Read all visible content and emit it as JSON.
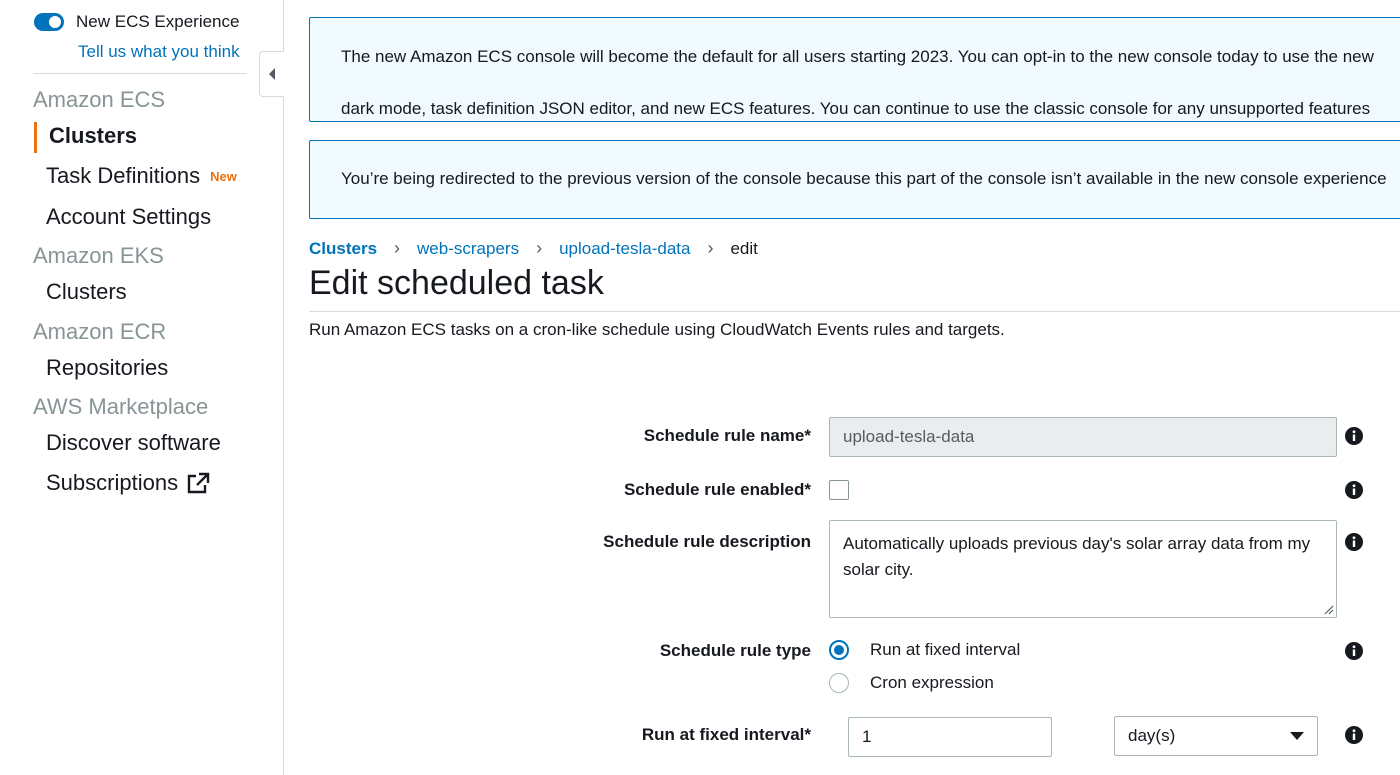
{
  "sidebar": {
    "toggle_label": "New ECS Experience",
    "feedback_link": "Tell us what you think",
    "sections": [
      {
        "title": "Amazon ECS"
      },
      {
        "title": "Amazon EKS"
      },
      {
        "title": "Amazon ECR"
      },
      {
        "title": "AWS Marketplace"
      }
    ],
    "items": {
      "ecs_clusters": "Clusters",
      "task_definitions": "Task Definitions",
      "task_definitions_badge": "New",
      "account_settings": "Account Settings",
      "eks_clusters": "Clusters",
      "repositories": "Repositories",
      "discover_software": "Discover software",
      "subscriptions": "Subscriptions"
    }
  },
  "banners": {
    "optin_line1": "The new Amazon ECS console will become the default for all users starting 2023. You can opt-in to the new console today to use the new",
    "optin_line2": "dark mode, task definition JSON editor, and new ECS features. You can continue to use the classic console for any unsupported features",
    "redirect": "You’re being redirected to the previous version of the console because this part of the console isn’t available in the new console experience"
  },
  "breadcrumb": [
    "Clusters",
    "web-scrapers",
    "upload-tesla-data",
    "edit"
  ],
  "page": {
    "title": "Edit scheduled task",
    "subtitle": "Run Amazon ECS tasks on a cron-like schedule using CloudWatch Events rules and targets."
  },
  "form": {
    "rule_name_label": "Schedule rule name*",
    "rule_name_value": "upload-tesla-data",
    "rule_enabled_label": "Schedule rule enabled*",
    "rule_enabled_checked": false,
    "description_label": "Schedule rule description",
    "description_value": "Automatically uploads previous day's solar array data from my solar city.",
    "rule_type_label": "Schedule rule type",
    "rule_type_options": [
      "Run at fixed interval",
      "Cron expression"
    ],
    "rule_type_selected": "Run at fixed interval",
    "interval_label": "Run at fixed interval*",
    "interval_value": "1",
    "interval_unit": "day(s)"
  },
  "colors": {
    "accent": "#0073bb",
    "active_marker": "#ec7211",
    "banner_bg": "#f1faff"
  },
  "icons": [
    "chevron-left-icon",
    "external-link-icon",
    "info-icon",
    "caret-down-icon",
    "resize-grip-icon"
  ]
}
